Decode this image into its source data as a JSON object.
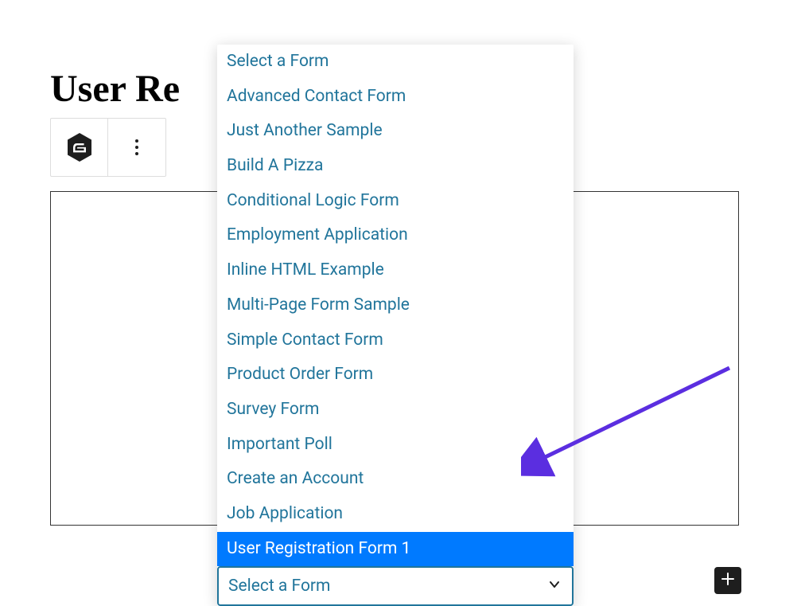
{
  "page": {
    "title": "User Re"
  },
  "toolbar": {
    "icons": {
      "block": "gravity-forms-icon",
      "more": "more-vertical-icon"
    }
  },
  "dropdown": {
    "options": [
      "Select a Form",
      "Advanced Contact Form",
      "Just Another Sample",
      "Build A Pizza",
      "Conditional Logic Form",
      "Employment Application",
      "Inline HTML Example",
      "Multi-Page Form Sample",
      "Simple Contact Form",
      "Product Order Form",
      "Survey Form",
      "Important Poll",
      "Create an Account",
      "Job Application",
      "User Registration Form 1"
    ],
    "highlighted_index": 14,
    "select_label": "Select a Form"
  },
  "colors": {
    "link": "#21759b",
    "highlight": "#007aff",
    "arrow": "#5b2ee0"
  }
}
